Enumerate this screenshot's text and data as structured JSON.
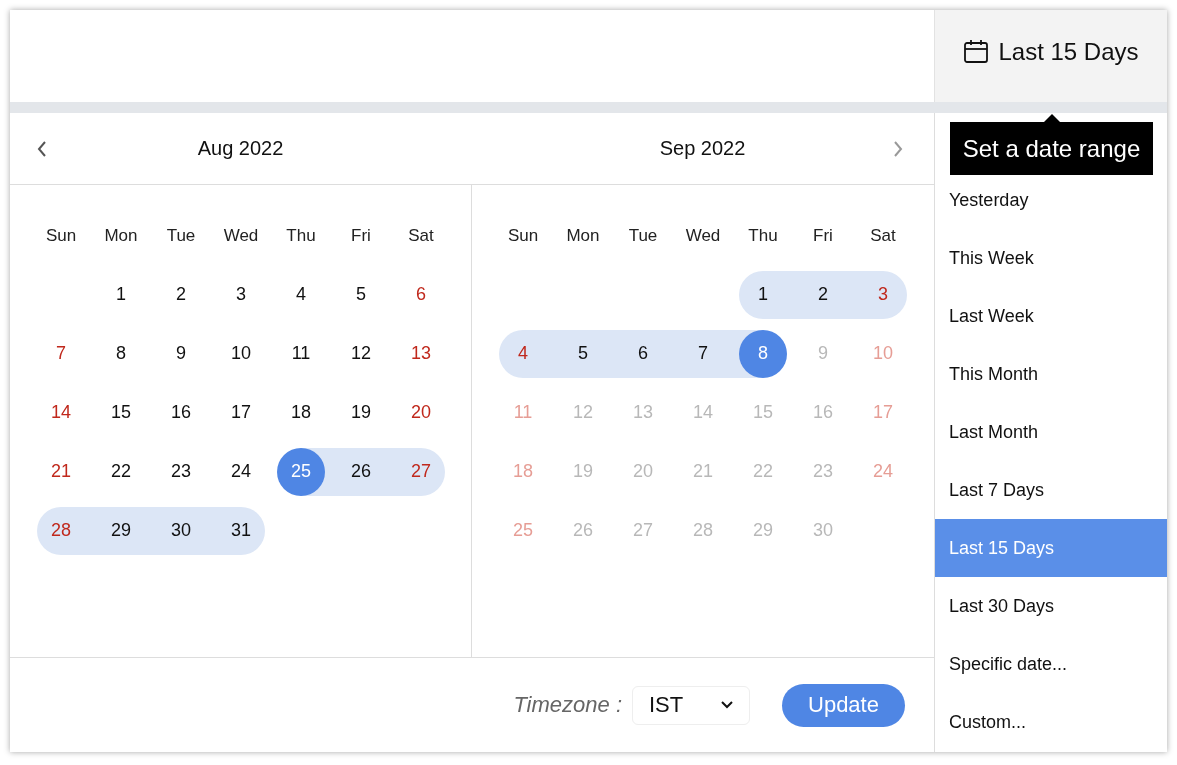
{
  "range_button": {
    "label": "Last 15 Days"
  },
  "tooltip": {
    "text": "Set a date range"
  },
  "months": [
    {
      "title": "Aug 2022",
      "weekdays": [
        "Sun",
        "Mon",
        "Tue",
        "Wed",
        "Thu",
        "Fri",
        "Sat"
      ],
      "weeks": [
        [
          {
            "kind": "blank"
          },
          {
            "kind": "day",
            "day": "1",
            "weekend": false,
            "dimmed": false,
            "in_range": false,
            "selected": false
          },
          {
            "kind": "day",
            "day": "2",
            "weekend": false,
            "dimmed": false,
            "in_range": false,
            "selected": false
          },
          {
            "kind": "day",
            "day": "3",
            "weekend": false,
            "dimmed": false,
            "in_range": false,
            "selected": false
          },
          {
            "kind": "day",
            "day": "4",
            "weekend": false,
            "dimmed": false,
            "in_range": false,
            "selected": false
          },
          {
            "kind": "day",
            "day": "5",
            "weekend": false,
            "dimmed": false,
            "in_range": false,
            "selected": false
          },
          {
            "kind": "day",
            "day": "6",
            "weekend": true,
            "dimmed": false,
            "in_range": false,
            "selected": false
          }
        ],
        [
          {
            "kind": "day",
            "day": "7",
            "weekend": true,
            "dimmed": false,
            "in_range": false,
            "selected": false
          },
          {
            "kind": "day",
            "day": "8",
            "weekend": false,
            "dimmed": false,
            "in_range": false,
            "selected": false
          },
          {
            "kind": "day",
            "day": "9",
            "weekend": false,
            "dimmed": false,
            "in_range": false,
            "selected": false
          },
          {
            "kind": "day",
            "day": "10",
            "weekend": false,
            "dimmed": false,
            "in_range": false,
            "selected": false
          },
          {
            "kind": "day",
            "day": "11",
            "weekend": false,
            "dimmed": false,
            "in_range": false,
            "selected": false
          },
          {
            "kind": "day",
            "day": "12",
            "weekend": false,
            "dimmed": false,
            "in_range": false,
            "selected": false
          },
          {
            "kind": "day",
            "day": "13",
            "weekend": true,
            "dimmed": false,
            "in_range": false,
            "selected": false
          }
        ],
        [
          {
            "kind": "day",
            "day": "14",
            "weekend": true,
            "dimmed": false,
            "in_range": false,
            "selected": false
          },
          {
            "kind": "day",
            "day": "15",
            "weekend": false,
            "dimmed": false,
            "in_range": false,
            "selected": false
          },
          {
            "kind": "day",
            "day": "16",
            "weekend": false,
            "dimmed": false,
            "in_range": false,
            "selected": false
          },
          {
            "kind": "day",
            "day": "17",
            "weekend": false,
            "dimmed": false,
            "in_range": false,
            "selected": false
          },
          {
            "kind": "day",
            "day": "18",
            "weekend": false,
            "dimmed": false,
            "in_range": false,
            "selected": false
          },
          {
            "kind": "day",
            "day": "19",
            "weekend": false,
            "dimmed": false,
            "in_range": false,
            "selected": false
          },
          {
            "kind": "day",
            "day": "20",
            "weekend": true,
            "dimmed": false,
            "in_range": false,
            "selected": false
          }
        ],
        [
          {
            "kind": "day",
            "day": "21",
            "weekend": true,
            "dimmed": false,
            "in_range": false,
            "selected": false
          },
          {
            "kind": "day",
            "day": "22",
            "weekend": false,
            "dimmed": false,
            "in_range": false,
            "selected": false
          },
          {
            "kind": "day",
            "day": "23",
            "weekend": false,
            "dimmed": false,
            "in_range": false,
            "selected": false
          },
          {
            "kind": "day",
            "day": "24",
            "weekend": false,
            "dimmed": false,
            "in_range": false,
            "selected": false
          },
          {
            "kind": "day",
            "day": "25",
            "weekend": false,
            "dimmed": false,
            "in_range": true,
            "selected": true
          },
          {
            "kind": "day",
            "day": "26",
            "weekend": false,
            "dimmed": false,
            "in_range": true,
            "selected": false
          },
          {
            "kind": "day",
            "day": "27",
            "weekend": true,
            "dimmed": false,
            "in_range": true,
            "selected": false
          }
        ],
        [
          {
            "kind": "day",
            "day": "28",
            "weekend": true,
            "dimmed": false,
            "in_range": true,
            "selected": false
          },
          {
            "kind": "day",
            "day": "29",
            "weekend": false,
            "dimmed": false,
            "in_range": true,
            "selected": false
          },
          {
            "kind": "day",
            "day": "30",
            "weekend": false,
            "dimmed": false,
            "in_range": true,
            "selected": false
          },
          {
            "kind": "day",
            "day": "31",
            "weekend": false,
            "dimmed": false,
            "in_range": true,
            "selected": false
          },
          {
            "kind": "blank"
          },
          {
            "kind": "blank"
          },
          {
            "kind": "blank"
          }
        ]
      ]
    },
    {
      "title": "Sep 2022",
      "weekdays": [
        "Sun",
        "Mon",
        "Tue",
        "Wed",
        "Thu",
        "Fri",
        "Sat"
      ],
      "weeks": [
        [
          {
            "kind": "blank"
          },
          {
            "kind": "blank"
          },
          {
            "kind": "blank"
          },
          {
            "kind": "blank"
          },
          {
            "kind": "day",
            "day": "1",
            "weekend": false,
            "dimmed": false,
            "in_range": true,
            "selected": false
          },
          {
            "kind": "day",
            "day": "2",
            "weekend": false,
            "dimmed": false,
            "in_range": true,
            "selected": false
          },
          {
            "kind": "day",
            "day": "3",
            "weekend": true,
            "dimmed": false,
            "in_range": true,
            "selected": false
          }
        ],
        [
          {
            "kind": "day",
            "day": "4",
            "weekend": true,
            "dimmed": false,
            "in_range": true,
            "selected": false
          },
          {
            "kind": "day",
            "day": "5",
            "weekend": false,
            "dimmed": false,
            "in_range": true,
            "selected": false
          },
          {
            "kind": "day",
            "day": "6",
            "weekend": false,
            "dimmed": false,
            "in_range": true,
            "selected": false
          },
          {
            "kind": "day",
            "day": "7",
            "weekend": false,
            "dimmed": false,
            "in_range": true,
            "selected": false
          },
          {
            "kind": "day",
            "day": "8",
            "weekend": false,
            "dimmed": false,
            "in_range": true,
            "selected": true
          },
          {
            "kind": "day",
            "day": "9",
            "weekend": false,
            "dimmed": true,
            "in_range": false,
            "selected": false
          },
          {
            "kind": "day",
            "day": "10",
            "weekend": true,
            "dimmed": true,
            "in_range": false,
            "selected": false
          }
        ],
        [
          {
            "kind": "day",
            "day": "11",
            "weekend": true,
            "dimmed": true,
            "in_range": false,
            "selected": false
          },
          {
            "kind": "day",
            "day": "12",
            "weekend": false,
            "dimmed": true,
            "in_range": false,
            "selected": false
          },
          {
            "kind": "day",
            "day": "13",
            "weekend": false,
            "dimmed": true,
            "in_range": false,
            "selected": false
          },
          {
            "kind": "day",
            "day": "14",
            "weekend": false,
            "dimmed": true,
            "in_range": false,
            "selected": false
          },
          {
            "kind": "day",
            "day": "15",
            "weekend": false,
            "dimmed": true,
            "in_range": false,
            "selected": false
          },
          {
            "kind": "day",
            "day": "16",
            "weekend": false,
            "dimmed": true,
            "in_range": false,
            "selected": false
          },
          {
            "kind": "day",
            "day": "17",
            "weekend": true,
            "dimmed": true,
            "in_range": false,
            "selected": false
          }
        ],
        [
          {
            "kind": "day",
            "day": "18",
            "weekend": true,
            "dimmed": true,
            "in_range": false,
            "selected": false
          },
          {
            "kind": "day",
            "day": "19",
            "weekend": false,
            "dimmed": true,
            "in_range": false,
            "selected": false
          },
          {
            "kind": "day",
            "day": "20",
            "weekend": false,
            "dimmed": true,
            "in_range": false,
            "selected": false
          },
          {
            "kind": "day",
            "day": "21",
            "weekend": false,
            "dimmed": true,
            "in_range": false,
            "selected": false
          },
          {
            "kind": "day",
            "day": "22",
            "weekend": false,
            "dimmed": true,
            "in_range": false,
            "selected": false
          },
          {
            "kind": "day",
            "day": "23",
            "weekend": false,
            "dimmed": true,
            "in_range": false,
            "selected": false
          },
          {
            "kind": "day",
            "day": "24",
            "weekend": true,
            "dimmed": true,
            "in_range": false,
            "selected": false
          }
        ],
        [
          {
            "kind": "day",
            "day": "25",
            "weekend": true,
            "dimmed": true,
            "in_range": false,
            "selected": false
          },
          {
            "kind": "day",
            "day": "26",
            "weekend": false,
            "dimmed": true,
            "in_range": false,
            "selected": false
          },
          {
            "kind": "day",
            "day": "27",
            "weekend": false,
            "dimmed": true,
            "in_range": false,
            "selected": false
          },
          {
            "kind": "day",
            "day": "28",
            "weekend": false,
            "dimmed": true,
            "in_range": false,
            "selected": false
          },
          {
            "kind": "day",
            "day": "29",
            "weekend": false,
            "dimmed": true,
            "in_range": false,
            "selected": false
          },
          {
            "kind": "day",
            "day": "30",
            "weekend": false,
            "dimmed": true,
            "in_range": false,
            "selected": false
          },
          {
            "kind": "blank"
          }
        ]
      ]
    }
  ],
  "footer": {
    "timezone_label": "Timezone :",
    "timezone": "IST",
    "update_button": "Update"
  },
  "presets": [
    {
      "label": "Yesterday",
      "selected": false
    },
    {
      "label": "This Week",
      "selected": false
    },
    {
      "label": "Last Week",
      "selected": false
    },
    {
      "label": "This Month",
      "selected": false
    },
    {
      "label": "Last Month",
      "selected": false
    },
    {
      "label": "Last 7 Days",
      "selected": false
    },
    {
      "label": "Last 15 Days",
      "selected": true
    },
    {
      "label": "Last 30 Days",
      "selected": false
    },
    {
      "label": "Specific date...",
      "selected": false
    },
    {
      "label": "Custom...",
      "selected": false
    }
  ]
}
